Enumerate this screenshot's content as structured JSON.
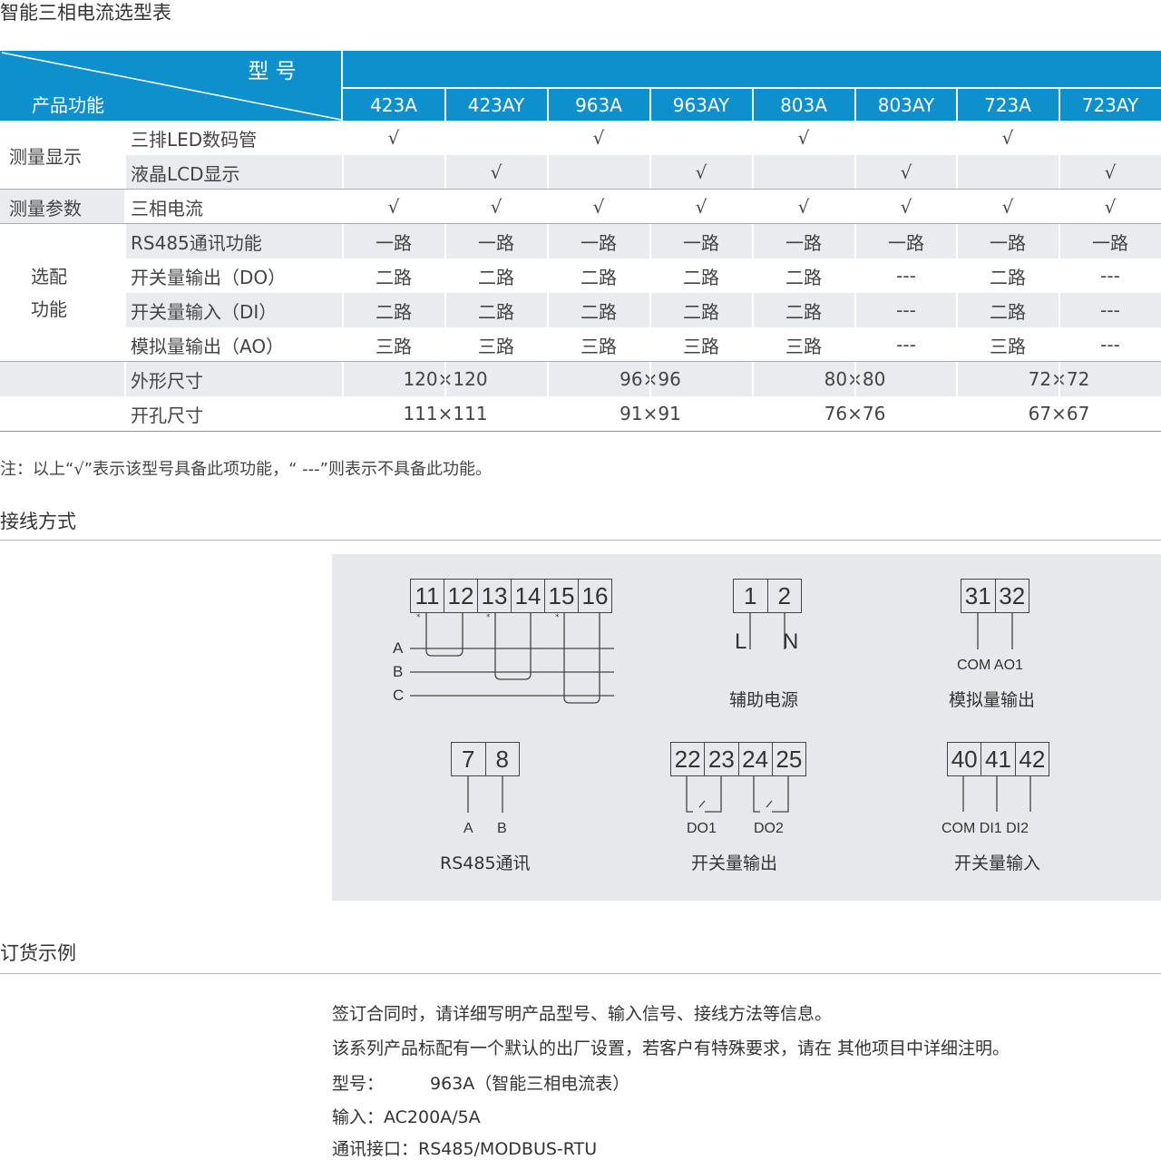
{
  "selection": {
    "title": "智能三相电流选型表",
    "corner_model": "型 号",
    "corner_function": "产品功能",
    "models": [
      "423A",
      "423AY",
      "963A",
      "963AY",
      "803A",
      "803AY",
      "723A",
      "723AY"
    ],
    "rows": [
      {
        "group": "测量显示",
        "feature": "三排LED数码管",
        "values": [
          "√",
          "",
          "√",
          "",
          "√",
          "",
          "√",
          ""
        ]
      },
      {
        "group": "",
        "feature": "液晶LCD显示",
        "values": [
          "",
          "√",
          "",
          "√",
          "",
          "√",
          "",
          "√"
        ]
      },
      {
        "group": "测量参数",
        "feature": "三相电流",
        "values": [
          "√",
          "√",
          "√",
          "√",
          "√",
          "√",
          "√",
          "√"
        ]
      },
      {
        "group": "",
        "feature": "RS485通讯功能",
        "values": [
          "一路",
          "一路",
          "一路",
          "一路",
          "一路",
          "一路",
          "一路",
          "一路"
        ]
      },
      {
        "group": "",
        "feature": "开关量输出（DO）",
        "values": [
          "二路",
          "二路",
          "二路",
          "二路",
          "二路",
          "---",
          "二路",
          "---"
        ]
      },
      {
        "group": "",
        "feature": "开关量输入（DI）",
        "values": [
          "二路",
          "二路",
          "二路",
          "二路",
          "二路",
          "---",
          "二路",
          "---"
        ]
      },
      {
        "group": "",
        "feature": "模拟量输出（AO）",
        "values": [
          "三路",
          "三路",
          "三路",
          "三路",
          "三路",
          "---",
          "三路",
          "---"
        ]
      }
    ],
    "optional_group": [
      "选配",
      "功能"
    ],
    "size_rows": [
      {
        "feature": "外形尺寸",
        "values": [
          "120×120",
          "96×96",
          "80×80",
          "72×72"
        ]
      },
      {
        "feature": "开孔尺寸",
        "values": [
          "111×111",
          "91×91",
          "76×76",
          "67×67"
        ]
      }
    ],
    "note": "注：以上“√”表示该型号具备此项功能，“ ---”则表示不具备此功能。"
  },
  "wiring": {
    "title": "接线方式",
    "current_terminals": [
      "11",
      "12",
      "13",
      "14",
      "15",
      "16"
    ],
    "phases": [
      "A",
      "B",
      "C"
    ],
    "power": {
      "terminals": [
        "1",
        "2"
      ],
      "labels": [
        "L",
        "N"
      ],
      "caption": "辅助电源"
    },
    "analog": {
      "terminals": [
        "31",
        "32"
      ],
      "labels": "COM AO1",
      "caption": "模拟量输出"
    },
    "rs485": {
      "terminals": [
        "7",
        "8"
      ],
      "labels": [
        "A",
        "B"
      ],
      "caption": "RS485通讯"
    },
    "do": {
      "terminals": [
        "22",
        "23",
        "24",
        "25"
      ],
      "labels": [
        "DO1",
        "DO2"
      ],
      "caption": "开关量输出"
    },
    "di": {
      "terminals": [
        "40",
        "41",
        "42"
      ],
      "labels": "COM DI1 DI2",
      "caption": "开关量输入"
    }
  },
  "order": {
    "title": "订货示例",
    "lines": [
      "签订合同时，请详细写明产品型号、输入信号、接线方法等信息。",
      "该系列产品标配有一个默认的出厂设置，若客户有特殊要求，请在 其他项目中详细注明。"
    ],
    "model_label": "型号：",
    "model_value": "963A（智能三相电流表）",
    "input_line": "输入：AC200A/5A",
    "comm_line": "通讯接口：RS485/MODBUS-RTU"
  },
  "colors": {
    "header": "#0e90cc",
    "row_shade": "#e9ebee",
    "panel": "#e6e8eb"
  }
}
